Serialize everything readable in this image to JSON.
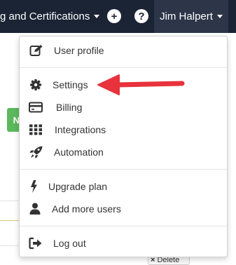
{
  "navbar": {
    "training_label": "g and Certifications",
    "plus_icon": "plus-circle-icon",
    "help_icon": "question-circle-icon",
    "user_name": "Jim Halpert"
  },
  "background": {
    "green_button_text": "N",
    "delete_button_text": "Delete"
  },
  "menu": {
    "items": [
      {
        "label": "User profile",
        "icon": "edit-icon"
      },
      {
        "label": "Settings",
        "icon": "gear-icon"
      },
      {
        "label": "Billing",
        "icon": "credit-card-icon"
      },
      {
        "label": "Integrations",
        "icon": "grid-icon"
      },
      {
        "label": "Automation",
        "icon": "rocket-icon"
      },
      {
        "label": "Upgrade plan",
        "icon": "bolt-icon"
      },
      {
        "label": "Add more users",
        "icon": "user-icon"
      },
      {
        "label": "Log out",
        "icon": "sign-out-icon"
      }
    ]
  },
  "colors": {
    "navbar_bg": "#1b2435",
    "user_menu_bg": "#2d3648",
    "arrow": "#e8323c",
    "green_button": "#5cb85c"
  }
}
